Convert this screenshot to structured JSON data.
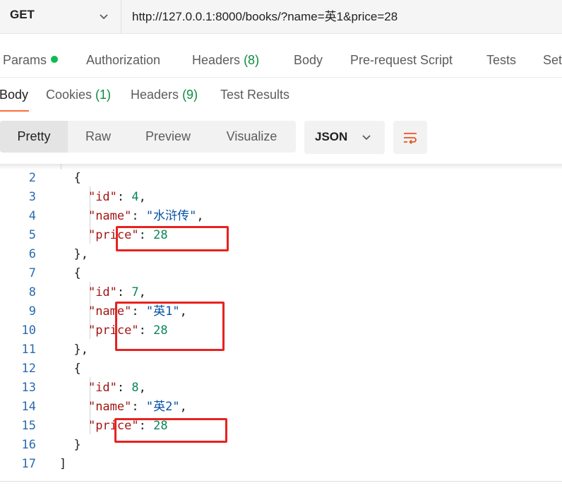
{
  "request": {
    "method": "GET",
    "url": "http://127.0.0.1:8000/books/?name=英1&price=28"
  },
  "request_tabs": [
    {
      "label": "Params",
      "count": ""
    },
    {
      "label": "Authorization",
      "count": ""
    },
    {
      "label": "Headers",
      "count": "(8)"
    },
    {
      "label": "Body",
      "count": ""
    },
    {
      "label": "Pre-request Script",
      "count": ""
    },
    {
      "label": "Tests",
      "count": ""
    },
    {
      "label": "Set",
      "count": ""
    }
  ],
  "response_tabs": [
    {
      "label": "Body",
      "count": ""
    },
    {
      "label": "Cookies",
      "count": "(1)"
    },
    {
      "label": "Headers",
      "count": "(9)"
    },
    {
      "label": "Test Results",
      "count": ""
    }
  ],
  "view_modes": [
    "Pretty",
    "Raw",
    "Preview",
    "Visualize"
  ],
  "format": "JSON",
  "code_lines": [
    {
      "ln": "2"
    },
    {
      "ln": "3"
    },
    {
      "ln": "4"
    },
    {
      "ln": "5"
    },
    {
      "ln": "6"
    },
    {
      "ln": "7"
    },
    {
      "ln": "8"
    },
    {
      "ln": "9"
    },
    {
      "ln": "10"
    },
    {
      "ln": "11"
    },
    {
      "ln": "12"
    },
    {
      "ln": "13"
    },
    {
      "ln": "14"
    },
    {
      "ln": "15"
    },
    {
      "ln": "16"
    },
    {
      "ln": "17"
    }
  ],
  "json": {
    "key_id": "\"id\"",
    "key_name": "\"name\"",
    "key_price": "\"price\"",
    "book1_id": "4",
    "book1_name": "\"水浒传\"",
    "book1_price": "28",
    "book2_id": "7",
    "book2_name": "\"英1\"",
    "book2_price": "28",
    "book3_id": "8",
    "book3_name": "\"英2\"",
    "book3_price": "28"
  },
  "icons": {
    "method_chevron": "chevron-down-icon",
    "format_chevron": "chevron-down-icon",
    "wrap": "wrap-lines-icon",
    "params_status": "status-dot-icon"
  },
  "colors": {
    "accent": "#ff6c37",
    "count": "#0c8c3e",
    "status_dot": "#0cbb52",
    "highlight": "#e8221f",
    "json_key": "#a31515",
    "json_string": "#0451a5",
    "json_number": "#098658"
  }
}
